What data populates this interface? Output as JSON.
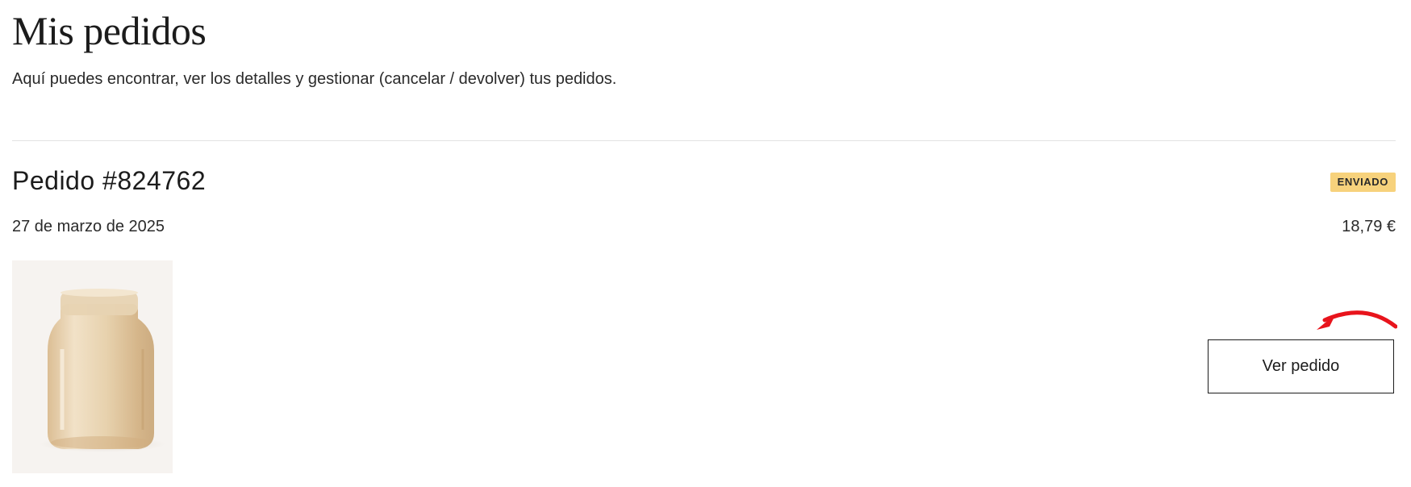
{
  "page": {
    "title": "Mis pedidos",
    "subtitle": "Aquí puedes encontrar, ver los detalles y gestionar (cancelar / devolver) tus pedidos."
  },
  "order": {
    "number_label": "Pedido #824762",
    "status": "ENVIADO",
    "date": "27 de marzo de 2025",
    "total": "18,79 €",
    "view_button_label": "Ver pedido",
    "product_icon": "glass-vase-image"
  },
  "colors": {
    "status_badge": "#f7d27c",
    "annotation_arrow": "#e8141c",
    "divider": "#e3e3e3"
  }
}
